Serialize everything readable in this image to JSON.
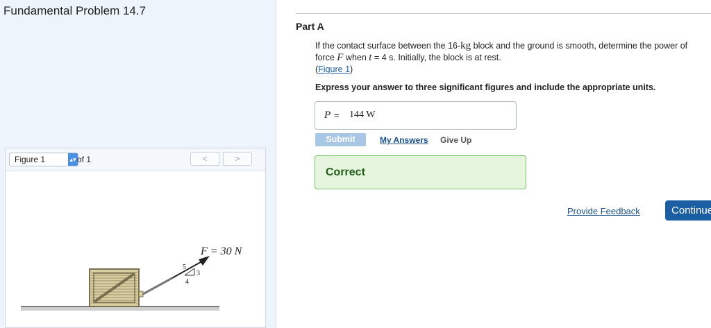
{
  "problem": {
    "title": "Fundamental Problem 14.7"
  },
  "figure_viewer": {
    "selected": "Figure 1",
    "of_text": "of 1",
    "prev_glyph": "<",
    "next_glyph": ">",
    "select_arrow_icon": "updown-chevron-icon",
    "figure": {
      "force_label": "F = 30 N",
      "slope_hyp": "5",
      "slope_rise": "3",
      "slope_run": "4"
    }
  },
  "part": {
    "label": "Part A",
    "question": {
      "pre1": "If the contact surface between the 16-",
      "unit_kg": "kg",
      "pre2": " block and the ground is smooth, determine the power of",
      "line2_a": "force ",
      "var_F": "F",
      "line2_b": " when ",
      "var_t": "t",
      "line2_c": " = 4 s. Initially, the block is at rest.",
      "figure_link_open": "(",
      "figure_link": "Figure 1",
      "figure_link_close": ")"
    },
    "instruction": "Express your answer to three significant figures and include the appropriate units.",
    "answer": {
      "variable": "P",
      "equals": "=",
      "value": "144 W"
    },
    "buttons": {
      "submit": "Submit",
      "my_answers": "My Answers",
      "give_up": "Give Up"
    },
    "result": "Correct",
    "feedback_link": "Provide Feedback",
    "continue": "Continue"
  }
}
